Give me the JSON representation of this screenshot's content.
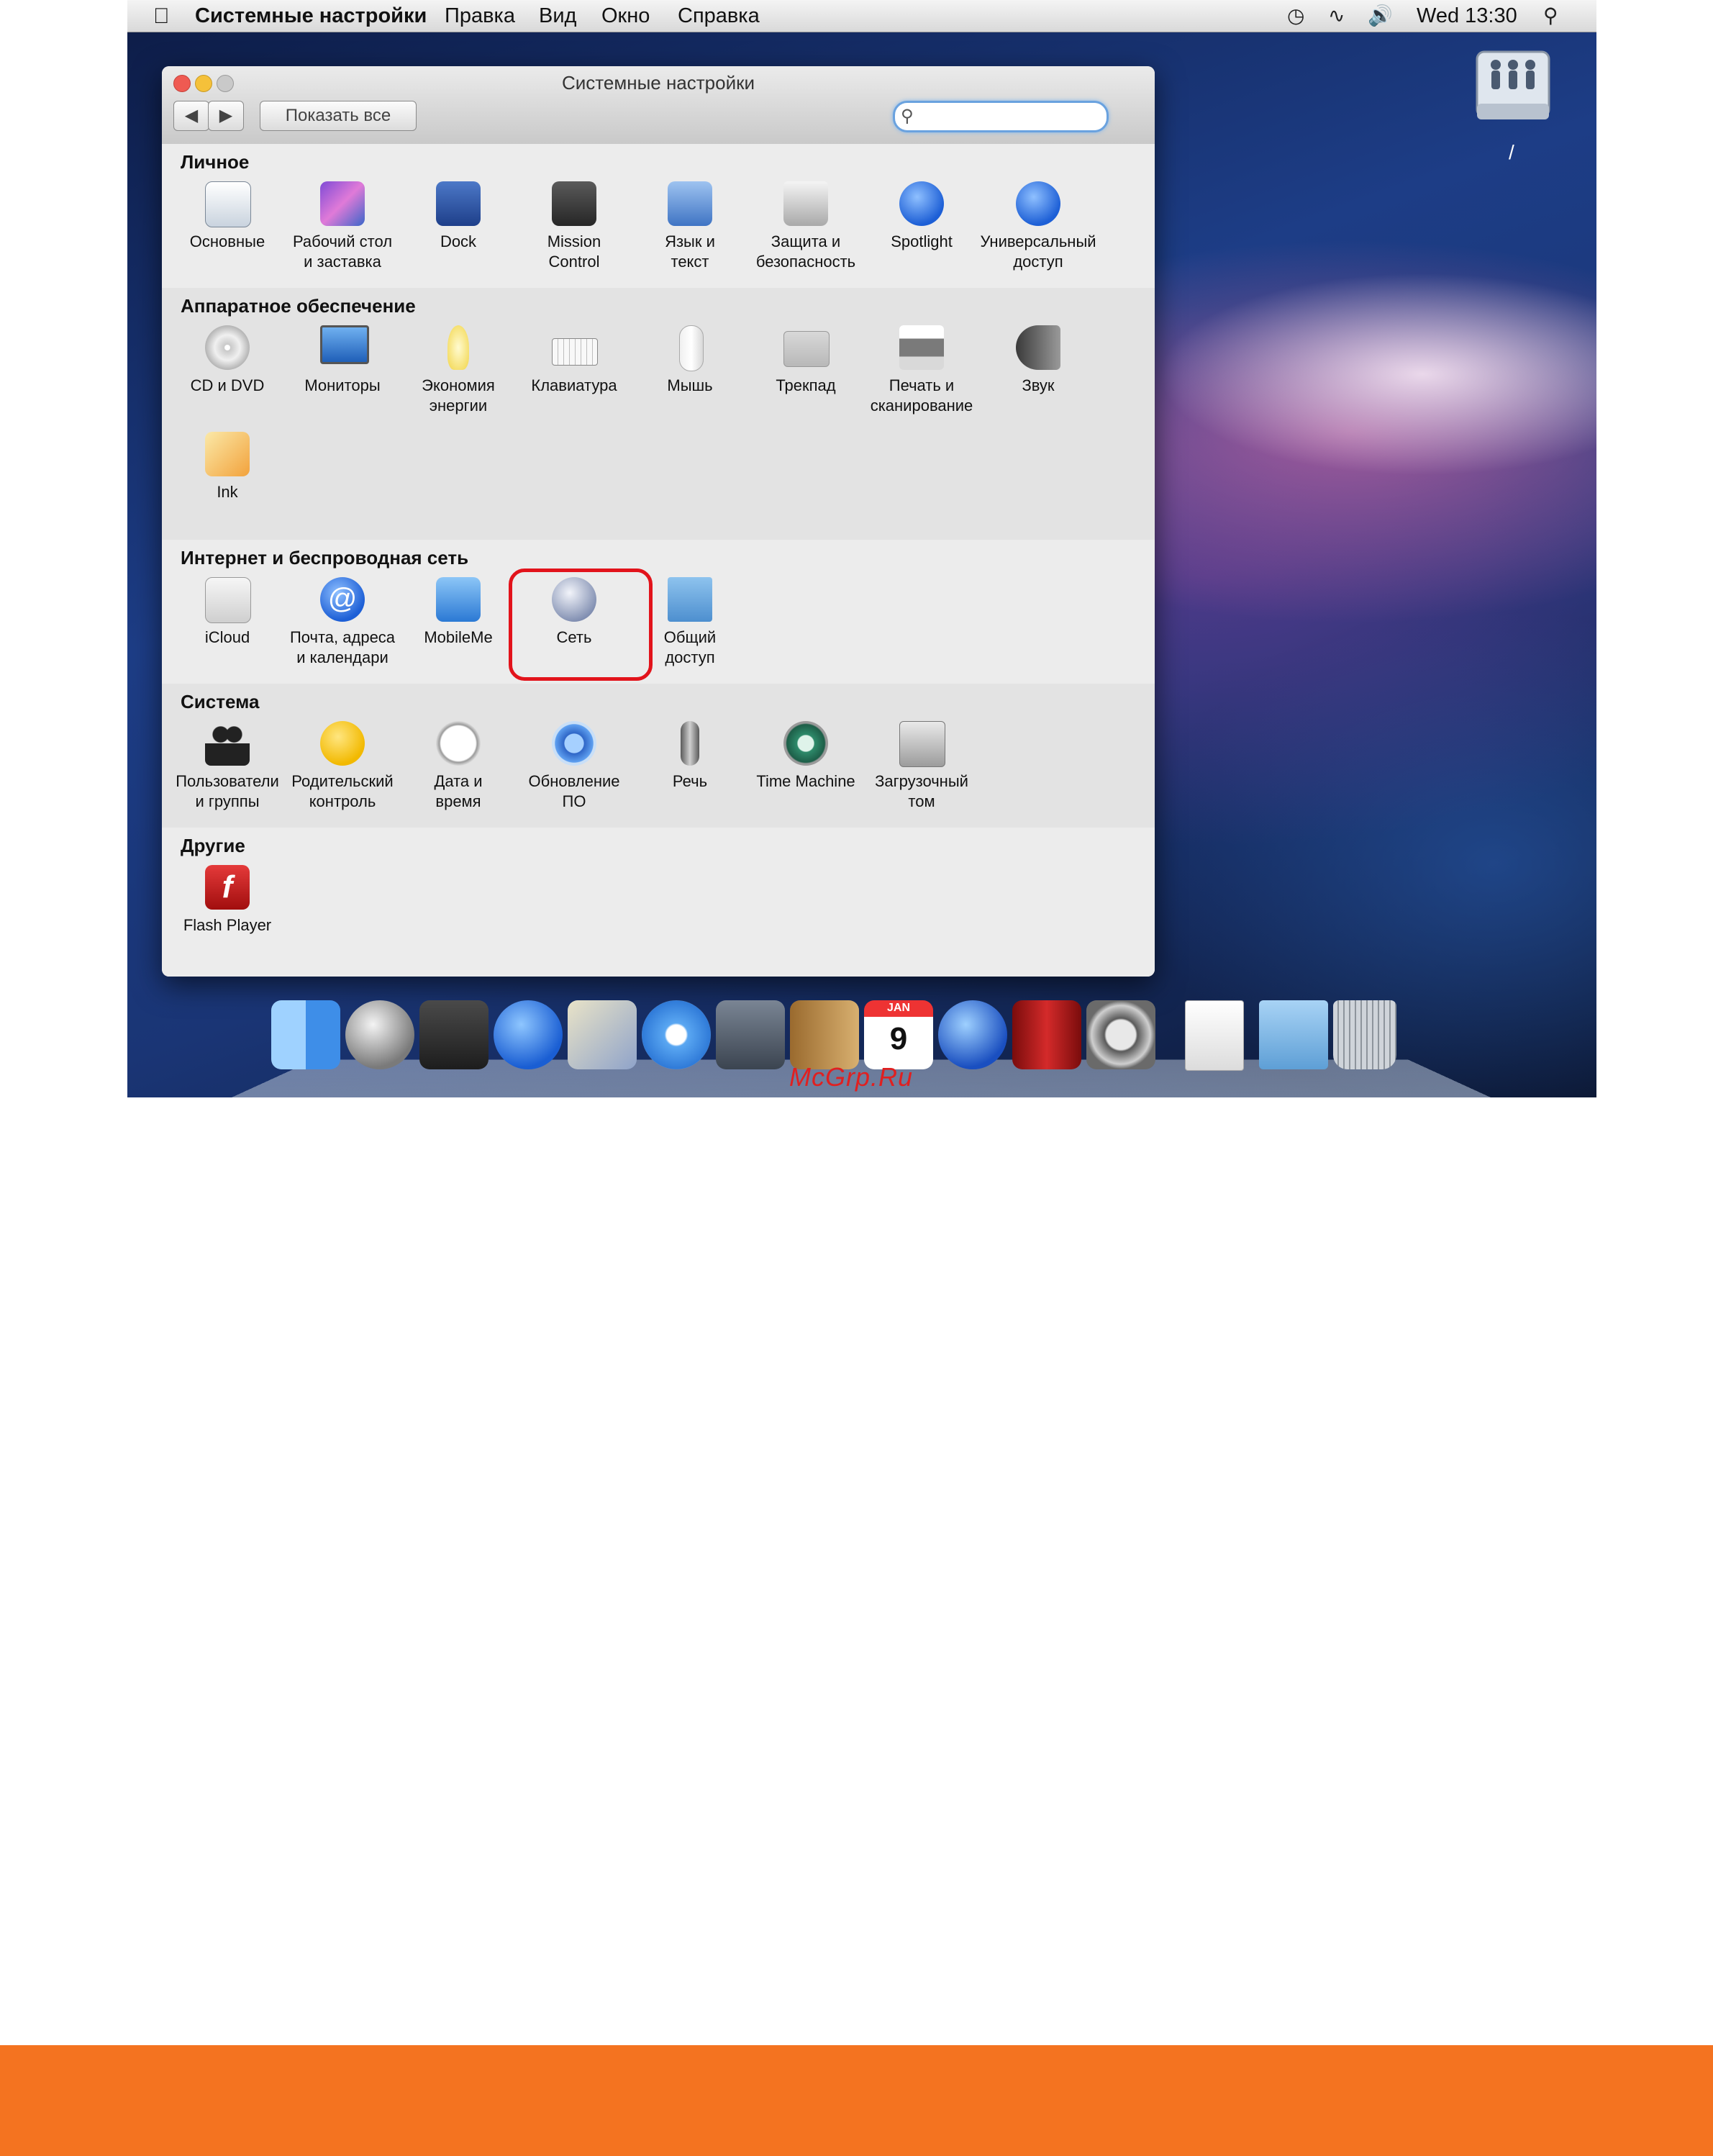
{
  "menubar": {
    "app_name": "Системные настройки",
    "menus": [
      "Правка",
      "Вид",
      "Окно",
      "Справка"
    ],
    "clock": "Wed 13:30",
    "icons": [
      "apple-logo",
      "time-machine-icon",
      "network-activity-icon",
      "volume-icon",
      "spotlight-icon"
    ]
  },
  "desktop": {
    "drive_label": "/"
  },
  "window": {
    "title": "Системные настройки",
    "show_all_label": "Показать все",
    "back_glyph": "◀",
    "forward_glyph": "▶",
    "search_placeholder": ""
  },
  "sections": [
    {
      "title": "Личное",
      "items": [
        "Основные",
        "Рабочий стол\nи заставка",
        "Dock",
        "Mission\nControl",
        "Язык и\nтекст",
        "Защита и\nбезопасность",
        "Spotlight",
        "Универсальный\nдоступ"
      ]
    },
    {
      "title": "Аппаратное обеспечение",
      "items": [
        "CD и DVD",
        "Мониторы",
        "Экономия\nэнергии",
        "Клавиатура",
        "Мышь",
        "Трекпад",
        "Печать и\nсканирование",
        "Звук",
        "Ink"
      ]
    },
    {
      "title": "Интернет и беспроводная сеть",
      "items": [
        "iCloud",
        "Почта, адреса\nи календари",
        "MobileMe",
        "Сеть",
        "Общий\nдоступ"
      ]
    },
    {
      "title": "Система",
      "items": [
        "Пользователи\nи группы",
        "Родительский\nконтроль",
        "Дата и\nвремя",
        "Обновление\nПО",
        "Речь",
        "Time Machine",
        "Загрузочный\nтом"
      ]
    },
    {
      "title": "Другие",
      "items": [
        "Flash Player"
      ]
    }
  ],
  "dock": {
    "items": [
      "finder-icon",
      "launchpad-icon",
      "mission-control-icon",
      "app-store-icon",
      "mail-icon",
      "safari-icon",
      "facetime-icon",
      "contacts-icon",
      "calendar-icon",
      "itunes-icon",
      "photo-booth-icon",
      "system-preferences-icon",
      "documents-stack-icon",
      "downloads-stack-icon",
      "trash-icon"
    ],
    "calendar_month": "JAN",
    "calendar_day": "9"
  },
  "watermark": "McGrp.Ru",
  "colors": {
    "highlight": "#e2131b",
    "footer": "#f47320",
    "search_focus": "#6aa2df"
  }
}
